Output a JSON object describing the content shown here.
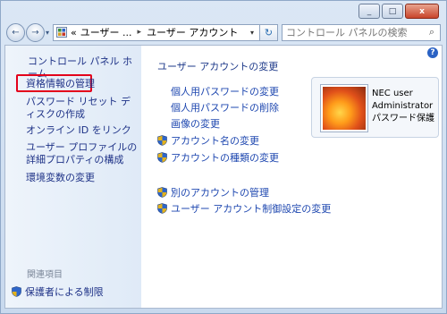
{
  "window": {
    "controls": [
      "_",
      "□",
      "x"
    ]
  },
  "nav": {
    "back_icon": "←",
    "forward_icon": "→",
    "dropdown_icon": "▾",
    "address": {
      "prefix": "«",
      "crumb1": "ユーザー ...",
      "separator": "▸",
      "crumb2": "ユーザー アカウント",
      "dropdown": "▾"
    },
    "refresh_icon": "↻",
    "search_placeholder": "コントロール パネルの検索",
    "search_icon": "⌕"
  },
  "help_icon": "?",
  "sidebar": {
    "home": "コントロール パネル ホーム",
    "credentials": "資格情報の管理",
    "password_reset": "パスワード リセット ディスクの作成",
    "online_id": "オンライン ID をリンク",
    "profile": "ユーザー プロファイルの詳細プロパティの構成",
    "env_vars": "環境変数の変更",
    "related_heading": "関連項目",
    "parental": "保護者による制限"
  },
  "main": {
    "title": "ユーザー アカウントの変更",
    "links": {
      "create_password": "個人用パスワードの変更",
      "remove_password": "個人用パスワードの削除",
      "change_picture": "画像の変更",
      "change_name": "アカウント名の変更",
      "change_type": "アカウントの種類の変更",
      "manage_other": "別のアカウントの管理",
      "uac": "ユーザー アカウント制御設定の変更"
    }
  },
  "user_card": {
    "name": "NEC user",
    "role": "Administrator",
    "status": "パスワード保護"
  },
  "colors": {
    "link": "#1f48b0",
    "highlight_box": "#e3001b",
    "sidebar_bg": "#e6eef8"
  }
}
